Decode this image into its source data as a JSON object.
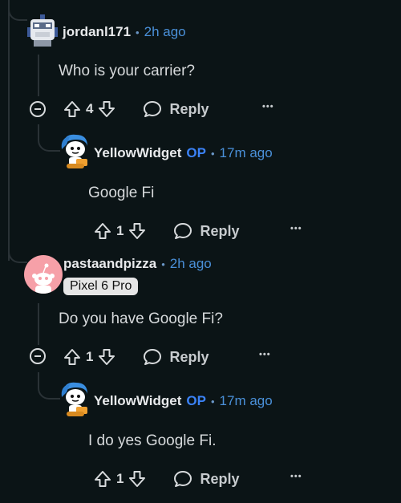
{
  "comments": [
    {
      "username": "jordanl171",
      "time": "2h ago",
      "body": "Who is your carrier?",
      "votes": "4",
      "reply_label": "Reply",
      "avatar_icon": "robot-avatar-icon"
    },
    {
      "username": "YellowWidget",
      "op_label": "OP",
      "time": "17m ago",
      "body": "Google Fi",
      "votes": "1",
      "reply_label": "Reply",
      "avatar_icon": "snoo-blue-hair-avatar-icon"
    },
    {
      "username": "pastaandpizza",
      "time": "2h ago",
      "flair": "Pixel 6 Pro",
      "body": "Do you have Google Fi?",
      "votes": "1",
      "reply_label": "Reply",
      "avatar_icon": "snoo-default-avatar-icon"
    },
    {
      "username": "YellowWidget",
      "op_label": "OP",
      "time": "17m ago",
      "body": "I do yes Google Fi.",
      "votes": "1",
      "reply_label": "Reply",
      "avatar_icon": "snoo-blue-hair-avatar-icon"
    }
  ],
  "separator": "•",
  "more_label": "•••",
  "colors": {
    "background": "#0b1416",
    "accent": "#4a90d9",
    "op": "#3b82f6"
  }
}
